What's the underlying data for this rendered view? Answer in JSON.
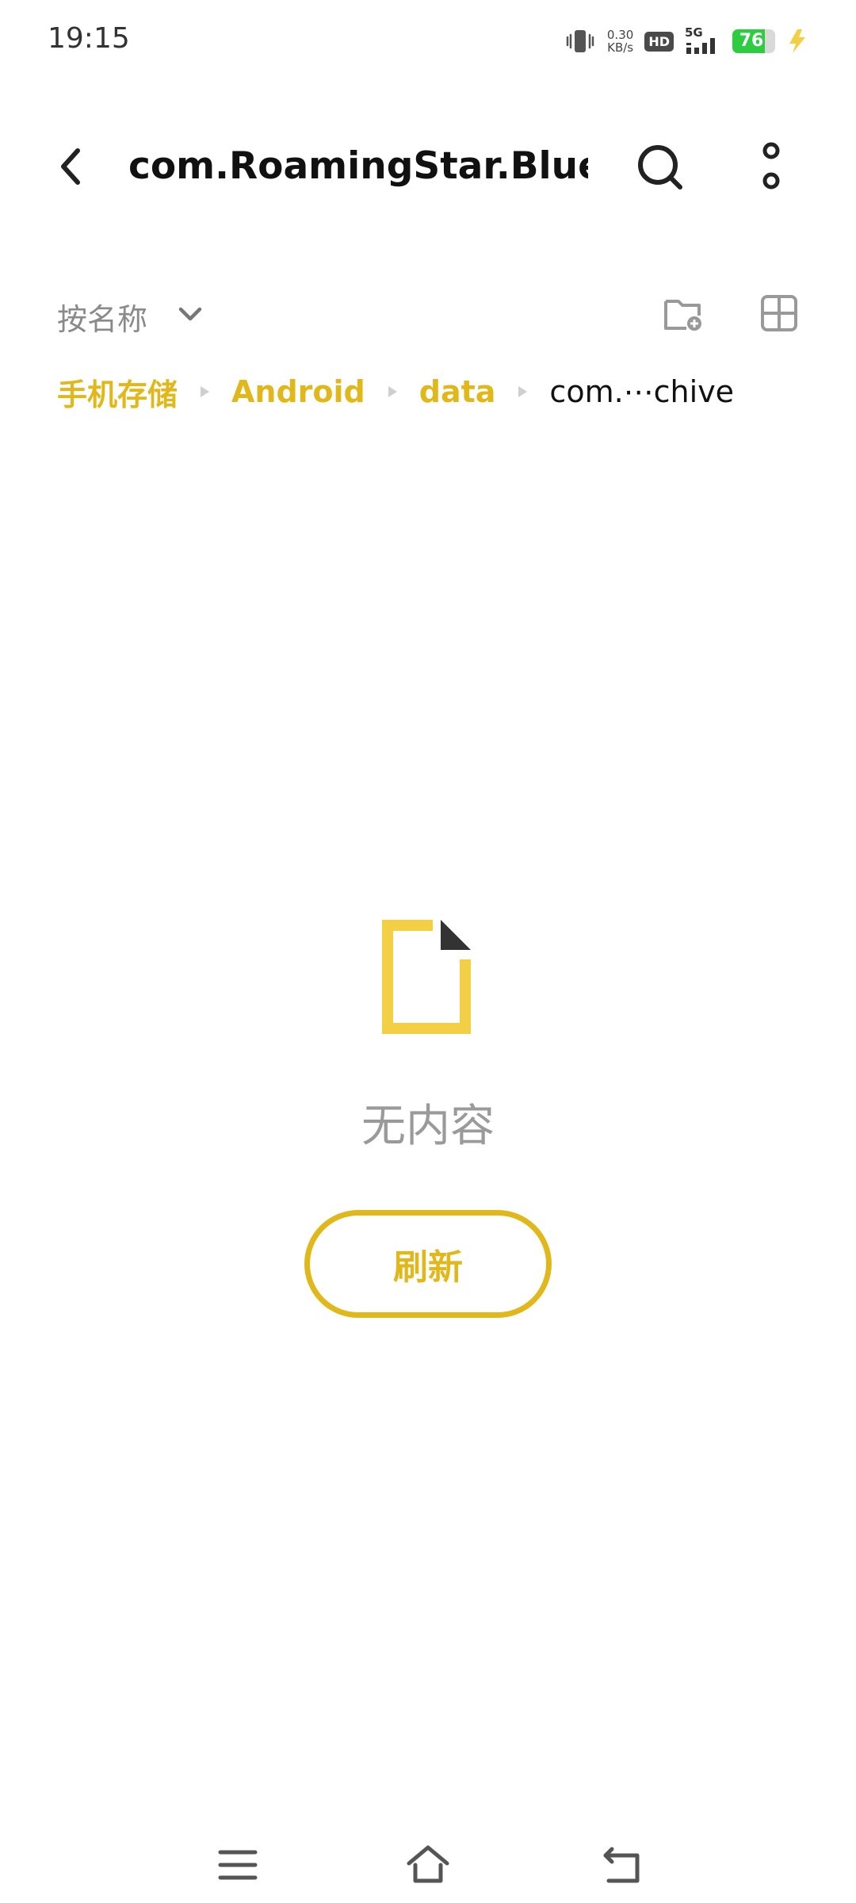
{
  "status_bar": {
    "time": "19:15",
    "net_speed_value": "0.30",
    "net_speed_unit": "KB/s",
    "hd_label": "HD",
    "network_type": "5G",
    "battery_level": "76",
    "battery_fraction": 0.76,
    "icons": [
      "vibrate-icon",
      "hd-icon",
      "signal-icon",
      "battery-icon",
      "charging-icon"
    ]
  },
  "app_bar": {
    "title": "com.RoamingStar.Blue⋯",
    "icons": [
      "back-arrow-icon",
      "search-icon",
      "more-vertical-icon"
    ]
  },
  "toolbar": {
    "sort_label": "按名称",
    "icons": [
      "chevron-down-icon",
      "new-folder-icon",
      "grid-view-icon"
    ]
  },
  "breadcrumb": {
    "items": [
      "手机存储",
      "Android",
      "data",
      "com.⋯chive"
    ]
  },
  "empty_state": {
    "icon": "empty-file-icon",
    "message": "无内容",
    "refresh_label": "刷新"
  },
  "colors": {
    "accent": "#e0b81c",
    "icon_yellow": "#f3cf45",
    "muted_text": "#9a9a9a",
    "battery_green": "#2ecc40"
  },
  "nav_bar": {
    "icons": [
      "menu-icon",
      "home-icon",
      "back-icon"
    ]
  }
}
